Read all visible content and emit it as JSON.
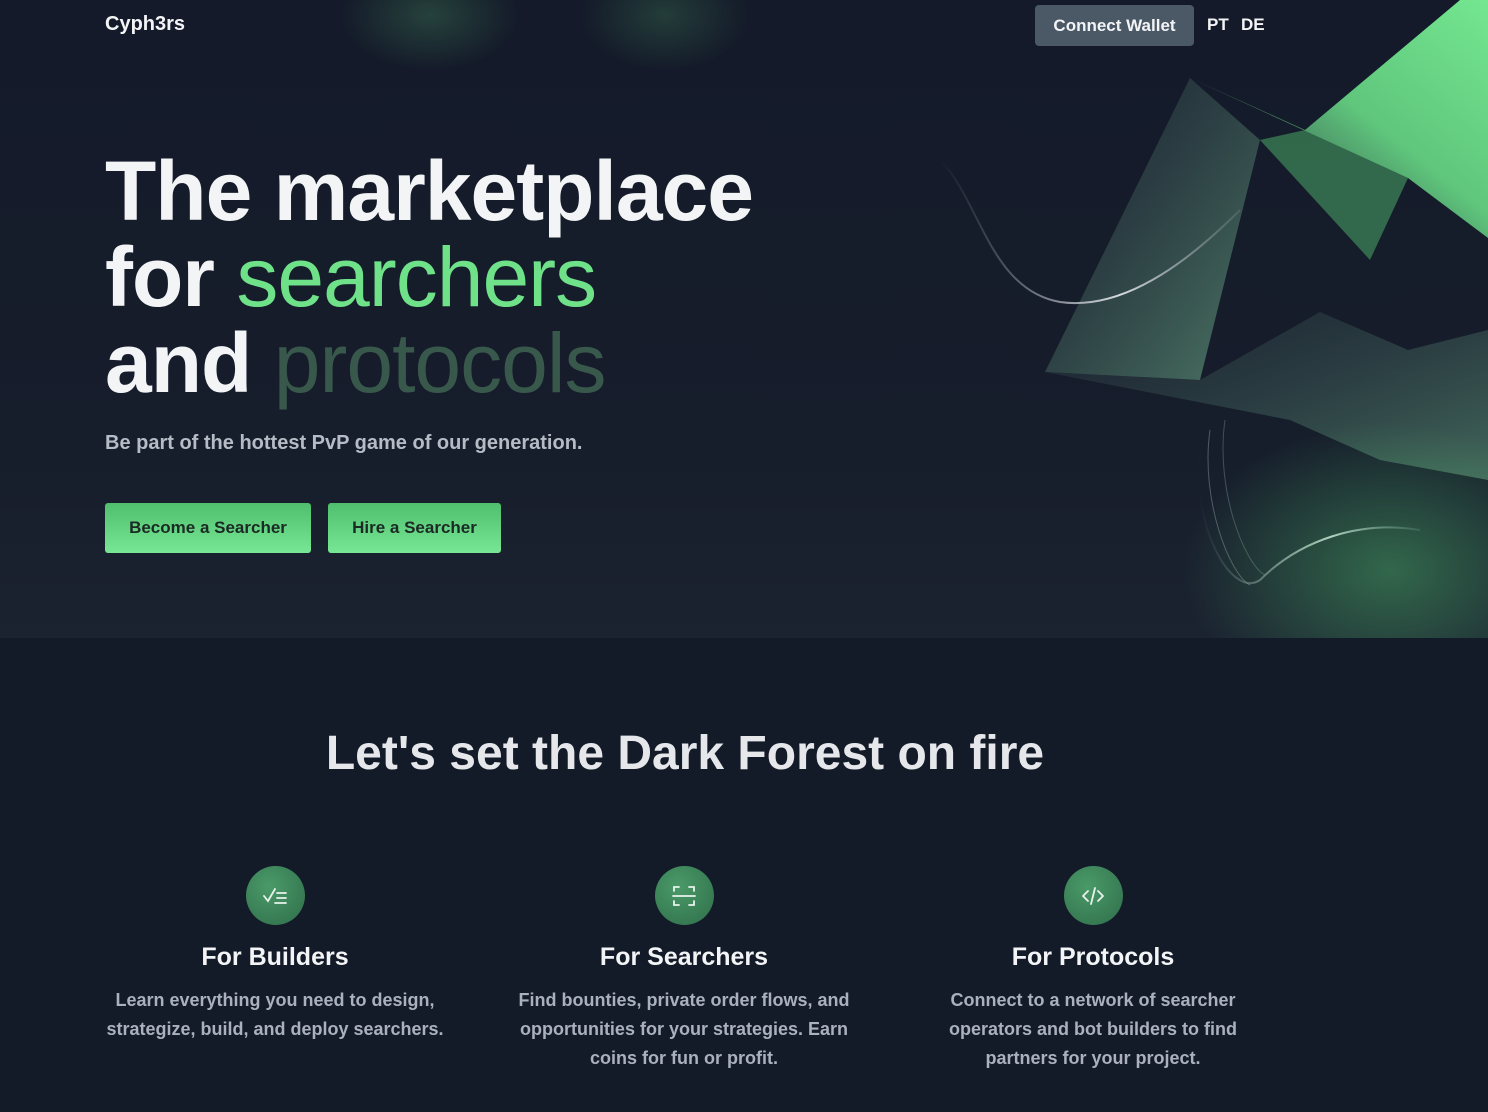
{
  "header": {
    "brand": "Cyph3rs",
    "connect_wallet_label": "Connect Wallet",
    "languages": [
      "PT",
      "DE"
    ]
  },
  "hero": {
    "line1": "The marketplace",
    "line2_bold": "for",
    "line2_accent": "searchers",
    "line3_bold": "and",
    "line3_accent": "protocols",
    "subtitle": "Be part of the hottest PvP game of our generation.",
    "cta_primary": "Become a Searcher",
    "cta_secondary": "Hire a Searcher"
  },
  "section": {
    "title": "Let's set the Dark Forest on fire",
    "features": [
      {
        "icon": "checklist-icon",
        "title": "For Builders",
        "description": "Learn everything you need to design, strategize, build, and deploy searchers."
      },
      {
        "icon": "scan-icon",
        "title": "For Searchers",
        "description": "Find bounties, private order flows, and opportunities for your strategies. Earn coins for fun or profit."
      },
      {
        "icon": "code-icon",
        "title": "For Protocols",
        "description": "Connect to a network of searcher operators and bot builders to find partners for your project."
      }
    ]
  },
  "colors": {
    "background": "#131a28",
    "accent_green": "#6ee189",
    "muted_green": "#39584c",
    "button_gray": "#4b5866"
  }
}
